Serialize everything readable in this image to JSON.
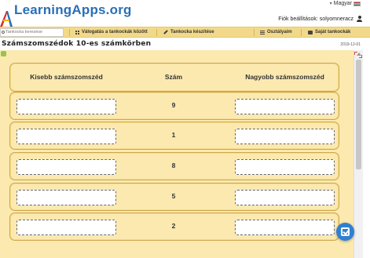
{
  "header": {
    "logo_text": "LearningApps.org",
    "language": "Magyar",
    "account_text": "Fiók beállítások: solyomneracz"
  },
  "nav": {
    "search_placeholder": "Tankocka keresése",
    "browse": "Válogatás a tankockák között",
    "create": "Tankocka készítése",
    "classes": "Osztályaim",
    "my_apps": "Saját tankockák"
  },
  "app": {
    "title": "Számszomszédok 10-es számkörben",
    "date": "2019-12-01"
  },
  "columns": {
    "left": "Kisebb számszomszéd",
    "middle": "Szám",
    "right": "Nagyobb számszomszéd"
  },
  "rows": [
    {
      "number": "9"
    },
    {
      "number": "1"
    },
    {
      "number": "8"
    },
    {
      "number": "5"
    },
    {
      "number": "2"
    }
  ],
  "colors": {
    "brand": "#2a6fb7",
    "nav_bg": "#f2d98a",
    "content_bg": "#fbe9b0",
    "check_button": "#2f80d1"
  }
}
